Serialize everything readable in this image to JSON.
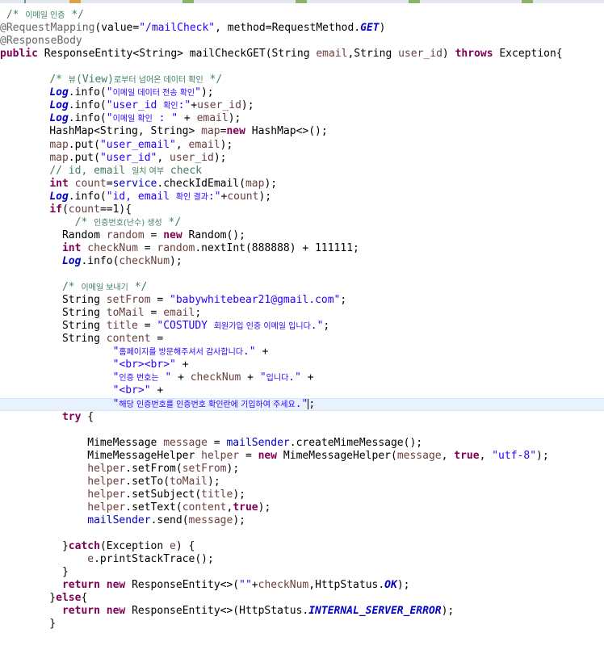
{
  "colors": {
    "keyword": "#7f0055",
    "string": "#2a00ff",
    "comment": "#3f7f5f",
    "local_variable": "#6a3e3e",
    "field": "#0000c0",
    "annotation": "#646464",
    "current_line": "#e8f2fe"
  },
  "code_lines": [
    [
      {
        "t": "cm",
        "v": " /* "
      },
      {
        "t": "cm",
        "v": "이메일 인증",
        "s": 1
      },
      {
        "t": "cm",
        "v": " */"
      }
    ],
    [
      {
        "t": "ann",
        "v": "@RequestMapping"
      },
      {
        "t": "plain",
        "v": "(value="
      },
      {
        "t": "str",
        "v": "\"/mailCheck\""
      },
      {
        "t": "plain",
        "v": ", method=RequestMethod."
      },
      {
        "t": "sfld",
        "v": "GET"
      },
      {
        "t": "plain",
        "v": ")"
      }
    ],
    [
      {
        "t": "ann",
        "v": "@ResponseBody"
      }
    ],
    [
      {
        "t": "kw",
        "v": "public"
      },
      {
        "t": "plain",
        "v": " ResponseEntity<String> mailCheckGET(String "
      },
      {
        "t": "var",
        "v": "email"
      },
      {
        "t": "plain",
        "v": ",String "
      },
      {
        "t": "var",
        "v": "user_id"
      },
      {
        "t": "plain",
        "v": ") "
      },
      {
        "t": "kw",
        "v": "throws"
      },
      {
        "t": "plain",
        "v": " Exception{"
      }
    ],
    [],
    [
      {
        "t": "plain",
        "v": "    "
      },
      {
        "t": "cm",
        "v": "/* "
      },
      {
        "t": "cm",
        "v": "뷰",
        "s": 1
      },
      {
        "t": "cm",
        "v": "(View)"
      },
      {
        "t": "cm",
        "v": "로부터 넘어온 데이터 확인",
        "s": 1
      },
      {
        "t": "cm",
        "v": " */"
      }
    ],
    [
      {
        "t": "plain",
        "v": "    "
      },
      {
        "t": "sfld",
        "v": "Log"
      },
      {
        "t": "plain",
        "v": ".info("
      },
      {
        "t": "str",
        "v": "\""
      },
      {
        "t": "str",
        "v": "이메일 데이터 전송 확인",
        "s": 1
      },
      {
        "t": "str",
        "v": "\""
      },
      {
        "t": "plain",
        "v": ");"
      }
    ],
    [
      {
        "t": "plain",
        "v": "    "
      },
      {
        "t": "sfld",
        "v": "Log"
      },
      {
        "t": "plain",
        "v": ".info("
      },
      {
        "t": "str",
        "v": "\"user_id "
      },
      {
        "t": "str",
        "v": "확인",
        "s": 1
      },
      {
        "t": "str",
        "v": ":\""
      },
      {
        "t": "plain",
        "v": "+"
      },
      {
        "t": "var",
        "v": "user_id"
      },
      {
        "t": "plain",
        "v": ");"
      }
    ],
    [
      {
        "t": "plain",
        "v": "    "
      },
      {
        "t": "sfld",
        "v": "Log"
      },
      {
        "t": "plain",
        "v": ".info("
      },
      {
        "t": "str",
        "v": "\""
      },
      {
        "t": "str",
        "v": "이메일 확인",
        "s": 1
      },
      {
        "t": "str",
        "v": " : \""
      },
      {
        "t": "plain",
        "v": " + "
      },
      {
        "t": "var",
        "v": "email"
      },
      {
        "t": "plain",
        "v": ");"
      }
    ],
    [
      {
        "t": "plain",
        "v": "    HashMap<String, String> "
      },
      {
        "t": "var",
        "v": "map"
      },
      {
        "t": "plain",
        "v": "="
      },
      {
        "t": "kw",
        "v": "new"
      },
      {
        "t": "plain",
        "v": " HashMap<>();"
      }
    ],
    [
      {
        "t": "plain",
        "v": "    "
      },
      {
        "t": "var",
        "v": "map"
      },
      {
        "t": "plain",
        "v": ".put("
      },
      {
        "t": "str",
        "v": "\"user_email\""
      },
      {
        "t": "plain",
        "v": ", "
      },
      {
        "t": "var",
        "v": "email"
      },
      {
        "t": "plain",
        "v": ");"
      }
    ],
    [
      {
        "t": "plain",
        "v": "    "
      },
      {
        "t": "var",
        "v": "map"
      },
      {
        "t": "plain",
        "v": ".put("
      },
      {
        "t": "str",
        "v": "\"user_id\""
      },
      {
        "t": "plain",
        "v": ", "
      },
      {
        "t": "var",
        "v": "user_id"
      },
      {
        "t": "plain",
        "v": ");"
      }
    ],
    [
      {
        "t": "plain",
        "v": "    "
      },
      {
        "t": "cm",
        "v": "// id, email "
      },
      {
        "t": "cm",
        "v": "일치 여부",
        "s": 1
      },
      {
        "t": "cm",
        "v": " check"
      }
    ],
    [
      {
        "t": "plain",
        "v": "    "
      },
      {
        "t": "kw",
        "v": "int"
      },
      {
        "t": "plain",
        "v": " "
      },
      {
        "t": "var",
        "v": "count"
      },
      {
        "t": "plain",
        "v": "="
      },
      {
        "t": "fld",
        "v": "service"
      },
      {
        "t": "plain",
        "v": ".checkIdEmail("
      },
      {
        "t": "var",
        "v": "map"
      },
      {
        "t": "plain",
        "v": ");"
      }
    ],
    [
      {
        "t": "plain",
        "v": "    "
      },
      {
        "t": "sfld",
        "v": "Log"
      },
      {
        "t": "plain",
        "v": ".info("
      },
      {
        "t": "str",
        "v": "\"id, email "
      },
      {
        "t": "str",
        "v": "확인 결과",
        "s": 1
      },
      {
        "t": "str",
        "v": ":\""
      },
      {
        "t": "plain",
        "v": "+"
      },
      {
        "t": "var",
        "v": "count"
      },
      {
        "t": "plain",
        "v": ");"
      }
    ],
    [
      {
        "t": "plain",
        "v": "    "
      },
      {
        "t": "kw",
        "v": "if"
      },
      {
        "t": "plain",
        "v": "("
      },
      {
        "t": "var",
        "v": "count"
      },
      {
        "t": "plain",
        "v": "==1){"
      }
    ],
    [
      {
        "t": "plain",
        "v": "        "
      },
      {
        "t": "cm",
        "v": "/* "
      },
      {
        "t": "cm",
        "v": "인증번호(난수) 생성",
        "s": 1
      },
      {
        "t": "cm",
        "v": " */"
      }
    ],
    [
      {
        "t": "plain",
        "v": "      Random "
      },
      {
        "t": "var",
        "v": "random"
      },
      {
        "t": "plain",
        "v": " = "
      },
      {
        "t": "kw",
        "v": "new"
      },
      {
        "t": "plain",
        "v": " Random();"
      }
    ],
    [
      {
        "t": "plain",
        "v": "      "
      },
      {
        "t": "kw",
        "v": "int"
      },
      {
        "t": "plain",
        "v": " "
      },
      {
        "t": "var",
        "v": "checkNum"
      },
      {
        "t": "plain",
        "v": " = "
      },
      {
        "t": "var",
        "v": "random"
      },
      {
        "t": "plain",
        "v": ".nextInt(888888) + 111111;"
      }
    ],
    [
      {
        "t": "plain",
        "v": "      "
      },
      {
        "t": "sfld",
        "v": "Log"
      },
      {
        "t": "plain",
        "v": ".info("
      },
      {
        "t": "var",
        "v": "checkNum"
      },
      {
        "t": "plain",
        "v": ");"
      }
    ],
    [],
    [
      {
        "t": "plain",
        "v": "      "
      },
      {
        "t": "cm",
        "v": "/* "
      },
      {
        "t": "cm",
        "v": "이메일 보내기",
        "s": 1
      },
      {
        "t": "cm",
        "v": " */"
      }
    ],
    [
      {
        "t": "plain",
        "v": "      String "
      },
      {
        "t": "var",
        "v": "setFrom"
      },
      {
        "t": "plain",
        "v": " = "
      },
      {
        "t": "str",
        "v": "\"babywhitebear21@gmail.com\""
      },
      {
        "t": "plain",
        "v": ";"
      }
    ],
    [
      {
        "t": "plain",
        "v": "      String "
      },
      {
        "t": "var",
        "v": "toMail"
      },
      {
        "t": "plain",
        "v": " = "
      },
      {
        "t": "var",
        "v": "email"
      },
      {
        "t": "plain",
        "v": ";"
      }
    ],
    [
      {
        "t": "plain",
        "v": "      String "
      },
      {
        "t": "var",
        "v": "title"
      },
      {
        "t": "plain",
        "v": " = "
      },
      {
        "t": "str",
        "v": "\"COSTUDY "
      },
      {
        "t": "str",
        "v": "회원가입 인증 이메일 입니다",
        "s": 1
      },
      {
        "t": "str",
        "v": ".\""
      },
      {
        "t": "plain",
        "v": ";"
      }
    ],
    [
      {
        "t": "plain",
        "v": "      String "
      },
      {
        "t": "var",
        "v": "content"
      },
      {
        "t": "plain",
        "v": " ="
      }
    ],
    [
      {
        "t": "plain",
        "v": "              "
      },
      {
        "t": "str",
        "v": "\""
      },
      {
        "t": "str",
        "v": "홈페이지를 방문해주셔서 감사합니다",
        "s": 1
      },
      {
        "t": "str",
        "v": ".\""
      },
      {
        "t": "plain",
        "v": " +"
      }
    ],
    [
      {
        "t": "plain",
        "v": "              "
      },
      {
        "t": "str",
        "v": "\"<br><br>\""
      },
      {
        "t": "plain",
        "v": " +"
      }
    ],
    [
      {
        "t": "plain",
        "v": "              "
      },
      {
        "t": "str",
        "v": "\""
      },
      {
        "t": "str",
        "v": "인증 번호는",
        "s": 1
      },
      {
        "t": "str",
        "v": " \""
      },
      {
        "t": "plain",
        "v": " + "
      },
      {
        "t": "var",
        "v": "checkNum"
      },
      {
        "t": "plain",
        "v": " + "
      },
      {
        "t": "str",
        "v": "\""
      },
      {
        "t": "str",
        "v": "입니다",
        "s": 1
      },
      {
        "t": "str",
        "v": ".\""
      },
      {
        "t": "plain",
        "v": " +"
      }
    ],
    [
      {
        "t": "plain",
        "v": "              "
      },
      {
        "t": "str",
        "v": "\"<br>\""
      },
      {
        "t": "plain",
        "v": " +"
      }
    ],
    [
      {
        "t": "plain",
        "v": "              "
      },
      {
        "t": "str",
        "v": "\""
      },
      {
        "t": "str",
        "v": "해당 인증번호를 인증번호 확인란에 기입하여 주세요",
        "s": 1
      },
      {
        "t": "str",
        "v": ".\""
      },
      {
        "t": "plain",
        "v": ";"
      }
    ],
    [
      {
        "t": "plain",
        "v": "      "
      },
      {
        "t": "kw",
        "v": "try"
      },
      {
        "t": "plain",
        "v": " {"
      }
    ],
    [],
    [
      {
        "t": "plain",
        "v": "          MimeMessage "
      },
      {
        "t": "var",
        "v": "message"
      },
      {
        "t": "plain",
        "v": " = "
      },
      {
        "t": "fld",
        "v": "mailSender"
      },
      {
        "t": "plain",
        "v": ".createMimeMessage();"
      }
    ],
    [
      {
        "t": "plain",
        "v": "          MimeMessageHelper "
      },
      {
        "t": "var",
        "v": "helper"
      },
      {
        "t": "plain",
        "v": " = "
      },
      {
        "t": "kw",
        "v": "new"
      },
      {
        "t": "plain",
        "v": " MimeMessageHelper("
      },
      {
        "t": "var",
        "v": "message"
      },
      {
        "t": "plain",
        "v": ", "
      },
      {
        "t": "kw",
        "v": "true"
      },
      {
        "t": "plain",
        "v": ", "
      },
      {
        "t": "str",
        "v": "\"utf-8\""
      },
      {
        "t": "plain",
        "v": ");"
      }
    ],
    [
      {
        "t": "plain",
        "v": "          "
      },
      {
        "t": "var",
        "v": "helper"
      },
      {
        "t": "plain",
        "v": ".setFrom("
      },
      {
        "t": "var",
        "v": "setFrom"
      },
      {
        "t": "plain",
        "v": ");"
      }
    ],
    [
      {
        "t": "plain",
        "v": "          "
      },
      {
        "t": "var",
        "v": "helper"
      },
      {
        "t": "plain",
        "v": ".setTo("
      },
      {
        "t": "var",
        "v": "toMail"
      },
      {
        "t": "plain",
        "v": ");"
      }
    ],
    [
      {
        "t": "plain",
        "v": "          "
      },
      {
        "t": "var",
        "v": "helper"
      },
      {
        "t": "plain",
        "v": ".setSubject("
      },
      {
        "t": "var",
        "v": "title"
      },
      {
        "t": "plain",
        "v": ");"
      }
    ],
    [
      {
        "t": "plain",
        "v": "          "
      },
      {
        "t": "var",
        "v": "helper"
      },
      {
        "t": "plain",
        "v": ".setText("
      },
      {
        "t": "var",
        "v": "content"
      },
      {
        "t": "plain",
        "v": ","
      },
      {
        "t": "kw",
        "v": "true"
      },
      {
        "t": "plain",
        "v": ");"
      }
    ],
    [
      {
        "t": "plain",
        "v": "          "
      },
      {
        "t": "fld",
        "v": "mailSender"
      },
      {
        "t": "plain",
        "v": ".send("
      },
      {
        "t": "var",
        "v": "message"
      },
      {
        "t": "plain",
        "v": ");"
      }
    ],
    [],
    [
      {
        "t": "plain",
        "v": "      }"
      },
      {
        "t": "kw",
        "v": "catch"
      },
      {
        "t": "plain",
        "v": "(Exception "
      },
      {
        "t": "var",
        "v": "e"
      },
      {
        "t": "plain",
        "v": ") {"
      }
    ],
    [
      {
        "t": "plain",
        "v": "          "
      },
      {
        "t": "var",
        "v": "e"
      },
      {
        "t": "plain",
        "v": ".printStackTrace();"
      }
    ],
    [
      {
        "t": "plain",
        "v": "      }"
      }
    ],
    [
      {
        "t": "plain",
        "v": "      "
      },
      {
        "t": "kw",
        "v": "return"
      },
      {
        "t": "plain",
        "v": " "
      },
      {
        "t": "kw",
        "v": "new"
      },
      {
        "t": "plain",
        "v": " ResponseEntity<>("
      },
      {
        "t": "str",
        "v": "\"\""
      },
      {
        "t": "plain",
        "v": "+"
      },
      {
        "t": "var",
        "v": "checkNum"
      },
      {
        "t": "plain",
        "v": ",HttpStatus."
      },
      {
        "t": "sfld",
        "v": "OK"
      },
      {
        "t": "plain",
        "v": ");"
      }
    ],
    [
      {
        "t": "plain",
        "v": "    }"
      },
      {
        "t": "kw",
        "v": "else"
      },
      {
        "t": "plain",
        "v": "{"
      }
    ],
    [
      {
        "t": "plain",
        "v": "      "
      },
      {
        "t": "kw",
        "v": "return"
      },
      {
        "t": "plain",
        "v": " "
      },
      {
        "t": "kw",
        "v": "new"
      },
      {
        "t": "plain",
        "v": " ResponseEntity<>(HttpStatus."
      },
      {
        "t": "sfld",
        "v": "INTERNAL_SERVER_ERROR"
      },
      {
        "t": "plain",
        "v": ");"
      }
    ],
    [
      {
        "t": "plain",
        "v": "    }"
      }
    ]
  ]
}
